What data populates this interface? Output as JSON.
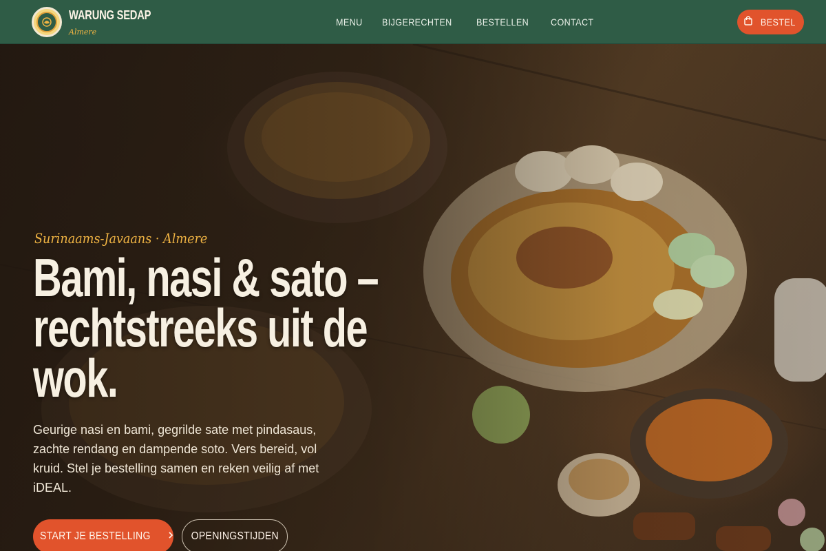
{
  "brand": {
    "name": "WARUNG SEDAP",
    "city": "Almere",
    "logo_icon": "batik-emblem-icon"
  },
  "nav": {
    "links": [
      "MENU",
      "BIJGERECHTEN",
      "BESTELLEN",
      "CONTACT"
    ],
    "order_button": {
      "label": "BESTEL",
      "icon": "shopping-bag-icon"
    }
  },
  "hero": {
    "eyebrow": "Surinaams-Javaans · Almere",
    "headline_lines": [
      "Bami, nasi & sato –",
      "rechtstreeks uit de",
      "wok."
    ],
    "intro": "Geurige nasi en bami, gegrilde sate met pindasaus, zachte rendang en dampende soto. Vers bereid, vol kruid. Stel je bestelling samen en reken veilig af met iDEAL.",
    "cta_primary": {
      "label": "START JE BESTELLING",
      "icon": "chevron-right-icon"
    },
    "cta_secondary": {
      "label": "OPENINGSTIJDEN"
    },
    "background_image": "food-spread-photo"
  },
  "colors": {
    "nav_bg": "#2f5c46",
    "accent": "#e1532c",
    "eyebrow": "#f0b443",
    "headline": "#f7f0e2"
  }
}
